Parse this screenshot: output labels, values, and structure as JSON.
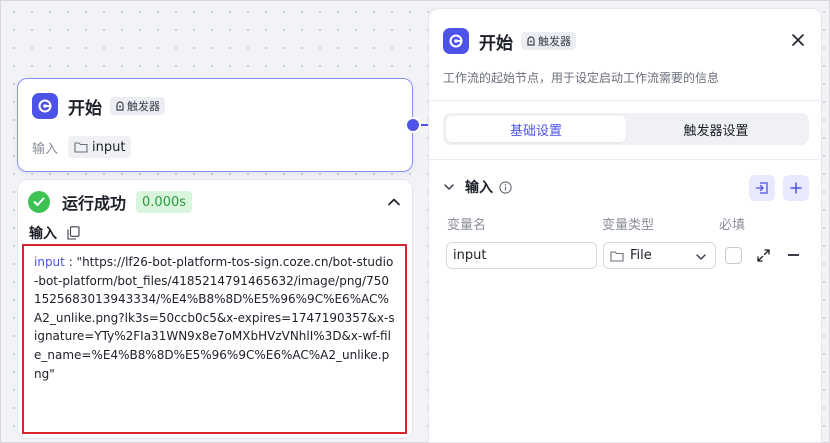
{
  "node": {
    "title": "开始",
    "badge": "触发器",
    "input_label": "输入",
    "input_tag": "input"
  },
  "result": {
    "status": "运行成功",
    "time": "0.000s",
    "section_label": "输入",
    "code_key": "input",
    "code_sep": " : ",
    "code_value": "\"https://lf26-bot-platform-tos-sign.coze.cn/bot-studio-bot-platform/bot_files/4185214791465632/image/png/7501525683013943334/%E4%B8%8D%E5%96%9C%E6%AC%A2_unlike.png?lk3s=50ccb0c5&x-expires=1747190357&x-signature=YTy%2FIa31WN9x8e7oMXbHVzVNhlI%3D&x-wf-file_name=%E4%B8%8D%E5%96%9C%E6%AC%A2_unlike.png\""
  },
  "panel": {
    "title": "开始",
    "badge": "触发器",
    "description": "工作流的起始节点，用于设定启动工作流需要的信息",
    "tabs": [
      {
        "label": "基础设置",
        "active": true
      },
      {
        "label": "触发器设置",
        "active": false
      }
    ],
    "section_title": "输入",
    "columns": {
      "name": "变量名",
      "type": "变量类型",
      "required": "必填"
    },
    "field": {
      "name_value": "input",
      "type_value": "File",
      "required": false
    }
  },
  "colors": {
    "accent": "#4d53e8",
    "success": "#3ec254",
    "highlight_border": "#d6272e"
  }
}
